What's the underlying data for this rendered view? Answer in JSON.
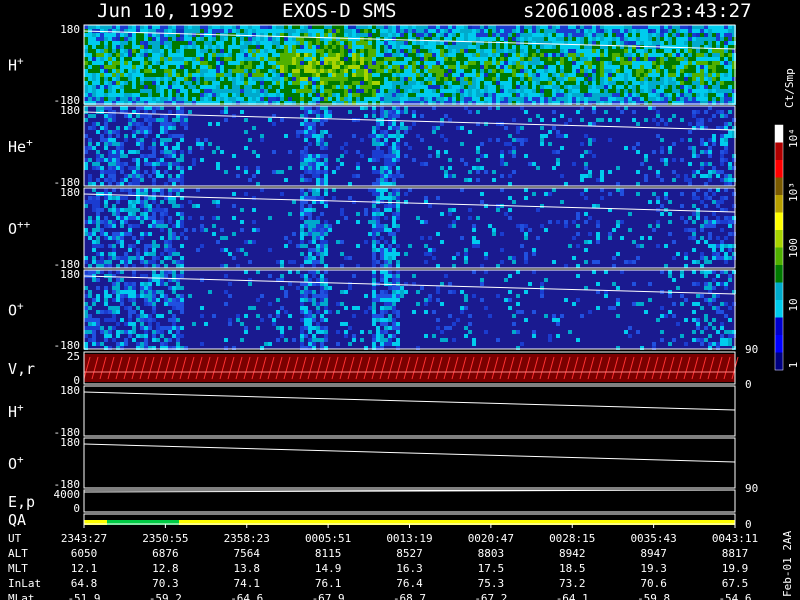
{
  "header": {
    "date": "Jun 10, 1992",
    "instrument": "EXOS-D SMS",
    "filename": "s2061008.asr",
    "time": "23:43:27"
  },
  "colorbar": {
    "unit": "Ct/Smp",
    "labels": [
      "10⁴",
      "10³",
      "100",
      "10",
      "1"
    ],
    "colors": [
      "#ffffff",
      "#b00000",
      "#ff0000",
      "#7a5a00",
      "#b8a000",
      "#ffff00",
      "#a8d400",
      "#50b000",
      "#007a00",
      "#00aacc",
      "#00ccee",
      "#0000cc",
      "#0000ff",
      "#000080"
    ]
  },
  "footer": {
    "side_label": "Feb-01 2AA",
    "rows": [
      {
        "label": "UT",
        "values": [
          "2343:27",
          "2350:55",
          "2358:23",
          "0005:51",
          "0013:19",
          "0020:47",
          "0028:15",
          "0035:43",
          "0043:11"
        ]
      },
      {
        "label": "ALT",
        "values": [
          "6050",
          "6876",
          "7564",
          "8115",
          "8527",
          "8803",
          "8942",
          "8947",
          "8817"
        ]
      },
      {
        "label": "MLT",
        "values": [
          "12.1",
          "12.8",
          "13.8",
          "14.9",
          "16.3",
          "17.5",
          "18.5",
          "19.3",
          "19.9"
        ]
      },
      {
        "label": "InLat",
        "values": [
          "64.8",
          "70.3",
          "74.1",
          "76.1",
          "76.4",
          "75.3",
          "73.2",
          "70.6",
          "67.5"
        ]
      },
      {
        "label": "MLat",
        "values": [
          "-51.9",
          "-59.2",
          "-64.6",
          "-67.9",
          "-68.7",
          "-67.2",
          "-64.1",
          "-59.8",
          "-54.6"
        ]
      }
    ]
  },
  "chart_data": {
    "type": "heatmap",
    "x_ticks": [
      "2343:27",
      "2350:55",
      "2358:23",
      "0005:51",
      "0013:19",
      "0020:47",
      "0028:15",
      "0035:43",
      "0043:11"
    ],
    "panels": [
      {
        "label": "H",
        "sup": "+",
        "ylim": [
          -180,
          180
        ],
        "y_ticks": [
          "180",
          "-180"
        ],
        "right_tick": "",
        "kind": "spectro",
        "bg": "#1030c0",
        "density": 0.95
      },
      {
        "label": "He",
        "sup": "+",
        "ylim": [
          -180,
          180
        ],
        "y_ticks": [
          "180",
          "-180"
        ],
        "right_tick": "",
        "kind": "spectro",
        "bg": "#1a1a90",
        "density": 0.25
      },
      {
        "label": "O",
        "sup": "++",
        "ylim": [
          -180,
          180
        ],
        "y_ticks": [
          "180",
          "-180"
        ],
        "right_tick": "",
        "kind": "spectro",
        "bg": "#1a1a90",
        "density": 0.2
      },
      {
        "label": "O",
        "sup": "+",
        "ylim": [
          -180,
          180
        ],
        "y_ticks": [
          "180",
          "-180"
        ],
        "right_tick": "90",
        "kind": "spectro",
        "bg": "#1a1a90",
        "density": 0.2
      },
      {
        "label": "V,r",
        "sup": "",
        "ylim": [
          0,
          25
        ],
        "y_ticks": [
          "25",
          "0"
        ],
        "right_tick": "0",
        "kind": "vr",
        "bg": "#000000",
        "density": 0
      },
      {
        "label": "H",
        "sup": "+",
        "ylim": [
          -180,
          180
        ],
        "y_ticks": [
          "180",
          "-180"
        ],
        "right_tick": "",
        "kind": "empty",
        "bg": "#000000",
        "density": 0
      },
      {
        "label": "O",
        "sup": "+",
        "ylim": [
          -180,
          180
        ],
        "y_ticks": [
          "180",
          "-180"
        ],
        "right_tick": "90",
        "kind": "empty",
        "bg": "#000000",
        "density": 0
      },
      {
        "label": "E,p",
        "sup": "",
        "ylim": [
          0,
          4000
        ],
        "y_ticks": [
          "4000",
          "0"
        ],
        "right_tick": "",
        "kind": "ep",
        "bg": "#000000",
        "density": 0
      },
      {
        "label": "QA",
        "sup": "",
        "ylim": [],
        "y_ticks": [],
        "right_tick": "0",
        "kind": "qa",
        "bg": "#000000",
        "density": 0
      }
    ]
  }
}
